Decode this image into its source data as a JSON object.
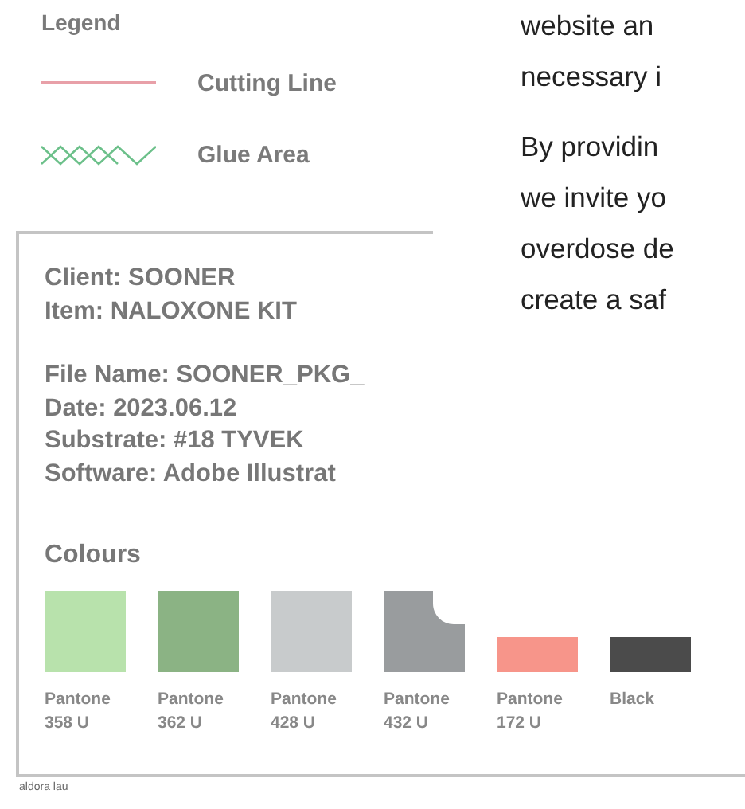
{
  "legend": {
    "title": "Legend",
    "items": [
      {
        "kind": "cutting",
        "label": "Cutting Line"
      },
      {
        "kind": "glue",
        "label": "Glue Area"
      }
    ]
  },
  "spec": {
    "client": "Client: SOONER",
    "item": "Item: NALOXONE KIT",
    "details": [
      "File Name: SOONER_PKG_",
      "Date: 2023.06.12",
      "Substrate: #18 TYVEK",
      "Software: Adobe Illustrat"
    ],
    "colours_title": "Colours",
    "swatches": [
      {
        "kind": "square",
        "color": "#b8e2ac",
        "label": "Pantone",
        "code": "358 U"
      },
      {
        "kind": "square",
        "color": "#8bb384",
        "label": "Pantone",
        "code": "362 U"
      },
      {
        "kind": "square",
        "color": "#c8cbcc",
        "label": "Pantone",
        "code": "428 U"
      },
      {
        "kind": "notched",
        "color": "#999c9e",
        "label": "Pantone",
        "code": "432 U"
      },
      {
        "kind": "bar",
        "color": "#f7958a",
        "label": "Pantone",
        "code": "172 U"
      },
      {
        "kind": "bar",
        "color": "#4b4b4b",
        "label": "Black"
      }
    ]
  },
  "credit": "aldora lau",
  "article": {
    "paragraphs": [
      {
        "lines": [
          "website an",
          "necessary i"
        ]
      },
      {
        "lines": [
          "By providin",
          "we invite yo",
          "overdose de",
          "create a saf"
        ]
      }
    ]
  }
}
